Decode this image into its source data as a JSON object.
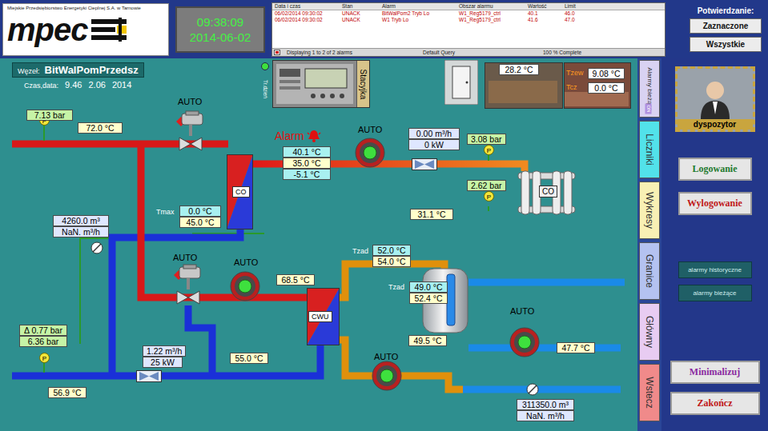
{
  "header": {
    "company": "Miejskie Przedsiębiorstwo Energetyki Cieplnej S.A. w Tarnowie",
    "logo": "mpec",
    "clock_time": "09:38:09",
    "clock_date": "2014-06-02"
  },
  "alarm_table": {
    "columns": [
      "Data i czas",
      "Stan",
      "Alarm",
      "Obszar alarmu",
      "Wartość",
      "Limit"
    ],
    "rows": [
      [
        "06/02/2014 09:30:02",
        "UNACK",
        "BitWalPom2 Tryb Lo",
        "W1_Reg5179_ctrl",
        "40.1",
        "46.0"
      ],
      [
        "06/02/2014 09:30:02",
        "UNACK",
        "W1 Tryb Lo",
        "W1_Reg5179_ctrl",
        "41.6",
        "47.0"
      ]
    ],
    "status": [
      "Displaying 1 to 2 of 2 alarms",
      "Default Query",
      "100 % Complete"
    ]
  },
  "acknowledge": {
    "title": "Potwierdzanie:",
    "buttons": [
      "Zaznaczone",
      "Wszystkie"
    ]
  },
  "node": {
    "label": "Węzeł:",
    "name": "BitWalPomPrzedsz",
    "time_label": "Czas,data:",
    "time": "9.46",
    "date": "2.06",
    "year": "2014"
  },
  "station": {
    "indicator_label": "Tr.dzień",
    "indicator_on": true,
    "controller_label": "Stacyjka"
  },
  "room_temp": "28.2 °C",
  "outdoor": [
    {
      "label": "Tzew",
      "value": "9.08 °C"
    },
    {
      "label": "Tcz",
      "value": "0.0 °C"
    }
  ],
  "alarm": {
    "text": "Alarm",
    "active": true
  },
  "valves": [
    {
      "mode": "AUTO"
    },
    {
      "mode": "AUTO"
    }
  ],
  "pumps": [
    {
      "mode": "AUTO",
      "running": true
    },
    {
      "mode": "AUTO",
      "running": true
    },
    {
      "mode": "AUTO",
      "running": true
    },
    {
      "mode": "AUTO",
      "running": true
    }
  ],
  "exchangers": [
    "CO",
    "CWU"
  ],
  "radiator": "CO",
  "gauges": [
    "P",
    "P",
    "P",
    "P"
  ],
  "tags": [
    "Tmax",
    "Tzad",
    "Tzad"
  ],
  "readings": [
    {
      "text": "7.13 bar",
      "kind": "pressure"
    },
    {
      "text": "72.0 °C",
      "kind": "temp"
    },
    {
      "text": "40.1 °C",
      "kind": "setpoint"
    },
    {
      "text": "35.0 °C",
      "kind": "temp"
    },
    {
      "text": "-5.1 °C",
      "kind": "setpoint"
    },
    {
      "text": "0.00 m³/h",
      "kind": "flow"
    },
    {
      "text": "0 kW",
      "kind": "flow"
    },
    {
      "text": "3.08 bar",
      "kind": "pressure"
    },
    {
      "text": "2.62 bar",
      "kind": "pressure"
    },
    {
      "text": "31.1 °C",
      "kind": "temp"
    },
    {
      "text": "0.0 °C",
      "kind": "setpoint"
    },
    {
      "text": "45.0 °C",
      "kind": "temp"
    },
    {
      "text": "4260.0 m³",
      "kind": "flow"
    },
    {
      "text": "NaN. m³/h",
      "kind": "flow"
    },
    {
      "text": "68.5 °C",
      "kind": "temp"
    },
    {
      "text": "52.0 °C",
      "kind": "setpoint"
    },
    {
      "text": "54.0 °C",
      "kind": "temp"
    },
    {
      "text": "49.0 °C",
      "kind": "setpoint"
    },
    {
      "text": "52.4 °C",
      "kind": "temp"
    },
    {
      "text": "49.5 °C",
      "kind": "temp"
    },
    {
      "text": "47.7 °C",
      "kind": "temp"
    },
    {
      "text": "Δ  0.77 bar",
      "kind": "pressure"
    },
    {
      "text": "6.36 bar",
      "kind": "pressure"
    },
    {
      "text": "1.22 m³/h",
      "kind": "flow"
    },
    {
      "text": "25 kW",
      "kind": "flow"
    },
    {
      "text": "55.0 °C",
      "kind": "temp"
    },
    {
      "text": "56.9 °C",
      "kind": "temp"
    },
    {
      "text": "311350.0 m³",
      "kind": "flow"
    },
    {
      "text": "NaN. m³/h",
      "kind": "flow"
    }
  ],
  "tabs": [
    {
      "label": "Alarmy bieżące",
      "badge": "ON",
      "selected": false,
      "color": "#d9d2f2"
    },
    {
      "label": "Liczniki",
      "selected": false,
      "color": "#52e2ea"
    },
    {
      "label": "Wykresy",
      "selected": false,
      "color": "#f8f0b4"
    },
    {
      "label": "Granice",
      "selected": false,
      "color": "#b4c2f0"
    },
    {
      "label": "Główny",
      "selected": false,
      "color": "#e8ccf2"
    },
    {
      "label": "Wstecz",
      "selected": false,
      "color": "#f08a8a"
    }
  ],
  "user": {
    "role": "dyspozytor"
  },
  "side_buttons": [
    {
      "label": "Logowanie",
      "kind": "large",
      "color": "#1f7a2e"
    },
    {
      "label": "Wylogowanie",
      "kind": "large",
      "color": "#c01818"
    },
    {
      "label": "alarmy historyczne",
      "kind": "small",
      "color": "#cfeeee"
    },
    {
      "label": "alarmy bieżące",
      "kind": "small",
      "color": "#cfeeee"
    },
    {
      "label": "Minimalizuj",
      "kind": "large",
      "color": "#8a2aa0"
    },
    {
      "label": "Zakończ",
      "kind": "large",
      "color": "#c01818"
    }
  ]
}
